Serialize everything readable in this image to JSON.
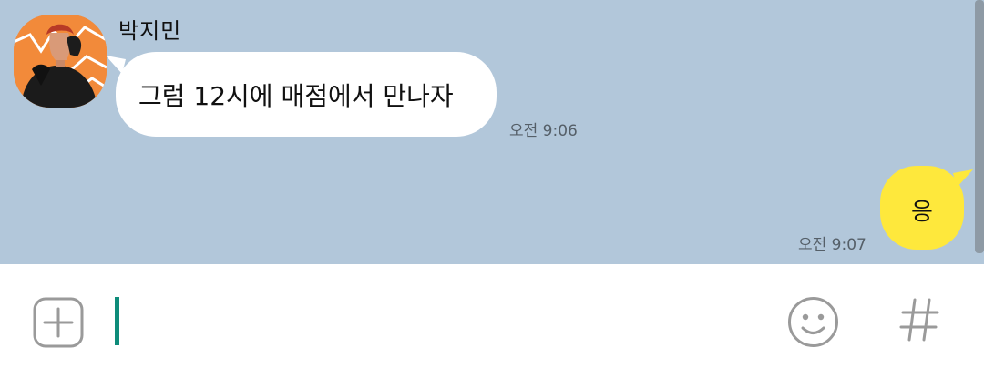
{
  "conversation": {
    "incoming": {
      "sender_name": "박지민",
      "message": "그럼 12시에 매점에서 만나자",
      "time": "오전 9:06"
    },
    "outgoing": {
      "message": "응",
      "time": "오전 9:07"
    }
  },
  "composer": {
    "input_value": "",
    "icons": {
      "add": "plus-square-icon",
      "emoji": "smiley-icon",
      "hashtag": "hashtag-icon"
    }
  },
  "colors": {
    "chat_background": "#b2c7da",
    "incoming_bubble": "#ffffff",
    "outgoing_bubble": "#fee83c",
    "caret": "#0e8c7a",
    "icon_gray": "#9a9a9a"
  }
}
